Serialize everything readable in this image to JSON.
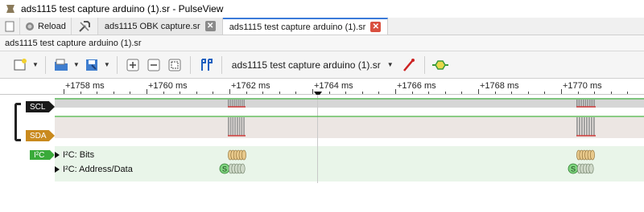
{
  "window": {
    "title": "ads1115 test capture arduino (1).sr - PulseView"
  },
  "tabbar": {
    "reload_label": "Reload",
    "tabs": [
      {
        "label": "ads1115 OBK capture.sr",
        "active": false
      },
      {
        "label": "ads1115 test capture arduino (1).sr",
        "active": true
      }
    ]
  },
  "session": {
    "label": "ads1115 test capture arduino (1).sr"
  },
  "toolbar": {
    "device_name": "ads1115 test capture arduino (1).sr"
  },
  "ruler": {
    "ticks": [
      "+1758 ms",
      "+1760 ms",
      "+1762 ms",
      "+1764 ms",
      "+1766 ms",
      "+1768 ms",
      "+1770 ms"
    ]
  },
  "channels": {
    "scl": {
      "name": "SCL",
      "color": "#1a1a1a"
    },
    "sda": {
      "name": "SDA",
      "color": "#c98a1e"
    }
  },
  "decoder": {
    "name": "I²C",
    "color": "#3aaa3a",
    "rows": [
      {
        "label": "I²C: Bits"
      },
      {
        "label": "I²C: Address/Data"
      }
    ],
    "start_marker": "S"
  },
  "colors": {
    "accent": "#3b7ad9",
    "trace_green": "#27b327",
    "trace_red": "#d23b3b",
    "bits_fill": "#e8c98c",
    "address_fill": "#cfd9c9",
    "start_fill": "#7fd47f"
  }
}
